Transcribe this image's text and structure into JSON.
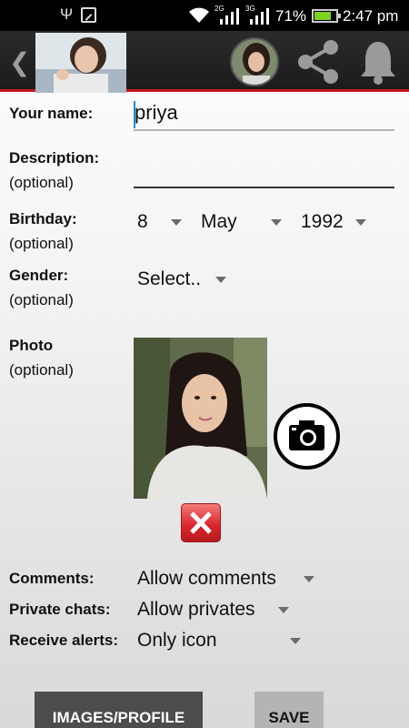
{
  "status_bar": {
    "network_1": "2G",
    "network_2": "3G",
    "battery_percent": "71%",
    "battery_level": 0.71,
    "time": "2:47 pm",
    "icons": [
      "usb-icon",
      "image-icon",
      "wifi-icon",
      "signal-icon",
      "battery-icon"
    ]
  },
  "action_bar": {
    "icons": [
      "back-icon",
      "app-logo",
      "avatar",
      "share-icon",
      "bell-icon"
    ]
  },
  "form": {
    "name": {
      "label": "Your name:",
      "value": "priya"
    },
    "description": {
      "label": "Description:",
      "optional": "(optional)",
      "value": ""
    },
    "birthday": {
      "label": "Birthday:",
      "optional": "(optional)",
      "day": "8",
      "month": "May",
      "year": "1992"
    },
    "gender": {
      "label": "Gender:",
      "optional": "(optional)",
      "value": "Select.."
    },
    "photo": {
      "label": "Photo",
      "optional": "(optional)"
    },
    "comments": {
      "label": "Comments:",
      "value": "Allow comments"
    },
    "private_chats": {
      "label": "Private chats:",
      "value": "Allow privates"
    },
    "receive_alerts": {
      "label": "Receive alerts:",
      "value": "Only icon"
    }
  },
  "buttons": {
    "images_profile": "IMAGES/PROFILE",
    "save": "SAVE"
  },
  "colors": {
    "accent_red": "#c41a1a",
    "focus_blue": "#1a8ad8",
    "battery_green": "#7ed321"
  }
}
